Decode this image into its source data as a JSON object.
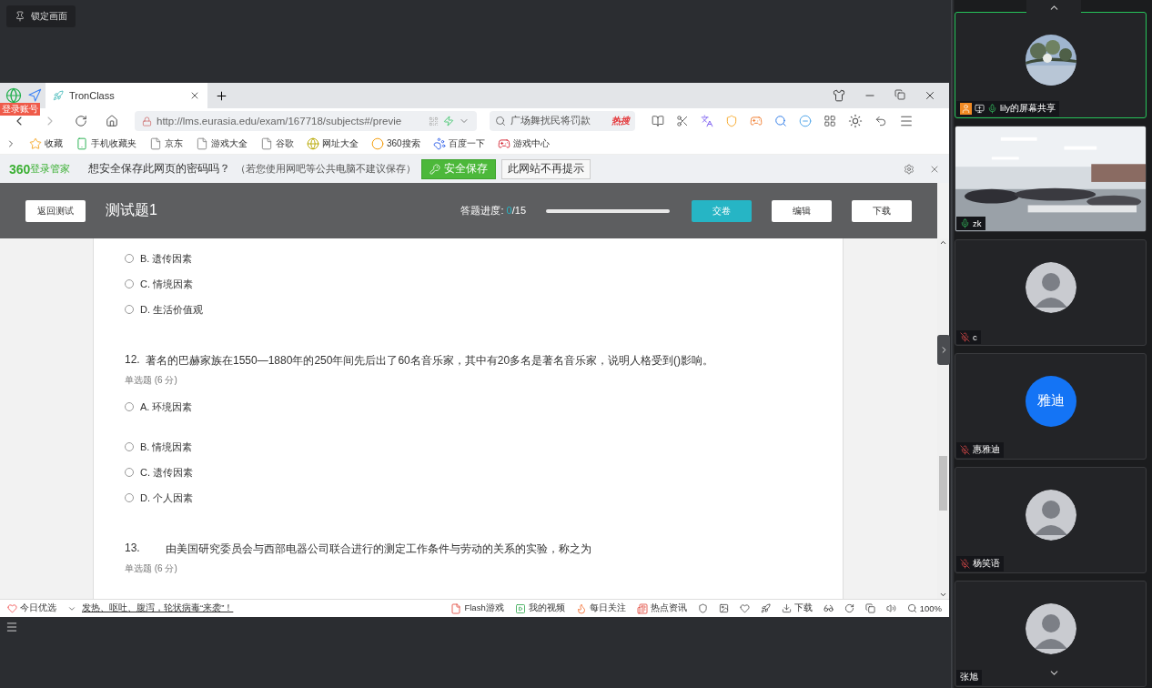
{
  "lock_badge": {
    "label": "锁定画面"
  },
  "browser": {
    "login_badge": "登录账号",
    "tabs": [
      {
        "title": "TronClass",
        "selected": true
      }
    ],
    "address": "http://lms.eurasia.edu/exam/167718/subjects#/previe",
    "search": {
      "value": "广场舞扰民将罚款",
      "badge": "热搜"
    },
    "bookmarks": [
      {
        "label": "收藏",
        "kind": "star"
      },
      {
        "label": "手机收藏夹",
        "kind": "phone"
      },
      {
        "label": "京东",
        "kind": "page"
      },
      {
        "label": "游戏大全",
        "kind": "page"
      },
      {
        "label": "谷歌",
        "kind": "page"
      },
      {
        "label": "网址大全",
        "kind": "globe"
      },
      {
        "label": "360搜索",
        "kind": "ring"
      },
      {
        "label": "百度一下",
        "kind": "paw"
      },
      {
        "label": "游戏中心",
        "kind": "game"
      }
    ],
    "password_bar": {
      "brand": "360",
      "brand_suffix": "登录管家",
      "question": "想安全保存此网页的密码吗？",
      "hint": "（若您使用网吧等公共电脑不建议保存）",
      "save": "安全保存",
      "dismiss": "此网站不再提示"
    },
    "status_bar": {
      "pick": "今日优选",
      "news": "发热、呕吐、腹泻，轮状病毒“来袭”！",
      "links": [
        {
          "label": "Flash游戏",
          "kind": "flash"
        },
        {
          "label": "我的视频",
          "kind": "video"
        },
        {
          "label": "每日关注",
          "kind": "flame"
        },
        {
          "label": "热点资讯",
          "kind": "news"
        }
      ],
      "download": "下载",
      "zoom": "100%"
    }
  },
  "exam": {
    "back": "返回测试",
    "title": "测试题1",
    "progress_label": "答题进度:",
    "answered": "0",
    "total": "/15",
    "level": 0,
    "buttons": [
      {
        "label": "交卷",
        "kind": "primary"
      },
      {
        "label": "编辑",
        "kind": "plain"
      },
      {
        "label": "下载",
        "kind": "plain"
      }
    ]
  },
  "questions": [
    {
      "options": [
        {
          "label": "B. 遗传因素",
          "selected": false
        },
        {
          "label": "C. 情境因素",
          "selected": false
        },
        {
          "label": "D. 生活价值观",
          "selected": false
        }
      ]
    },
    {
      "number": "12.",
      "text": "著名的巴赫家族在1550—1880年的250年间先后出了60名音乐家，其中有20多名是著名音乐家，说明人格受到()影响。",
      "type": "单选题 (6 分)",
      "options": [
        {
          "label": "A. 环境因素",
          "selected": false
        },
        {
          "label": "B. 情境因素",
          "selected": false
        },
        {
          "label": "C. 遗传因素",
          "selected": false
        },
        {
          "label": "D. 个人因素",
          "selected": false
        }
      ]
    },
    {
      "number": "13.",
      "text": "由美国研究委员会与西部电器公司联合进行的测定工作条件与劳动的关系的实验，称之为",
      "type": "单选题 (6 分)"
    }
  ],
  "participants": [
    {
      "name": "lily的屏幕共享",
      "kind": "picture",
      "muted": false,
      "sharing": true,
      "active": true
    },
    {
      "name": "zk",
      "kind": "video",
      "muted": false,
      "sharing": false,
      "active": false
    },
    {
      "name": "c",
      "kind": "silhouette",
      "muted": true,
      "sharing": false,
      "active": false
    },
    {
      "name": "惠雅迪",
      "kind": "initials",
      "initials": "雅迪",
      "muted": true,
      "sharing": false,
      "active": false
    },
    {
      "name": "杨笑语",
      "kind": "silhouette",
      "muted": true,
      "sharing": false,
      "active": false
    },
    {
      "name": "张旭",
      "kind": "silhouette",
      "sharing": false,
      "active": false
    }
  ]
}
